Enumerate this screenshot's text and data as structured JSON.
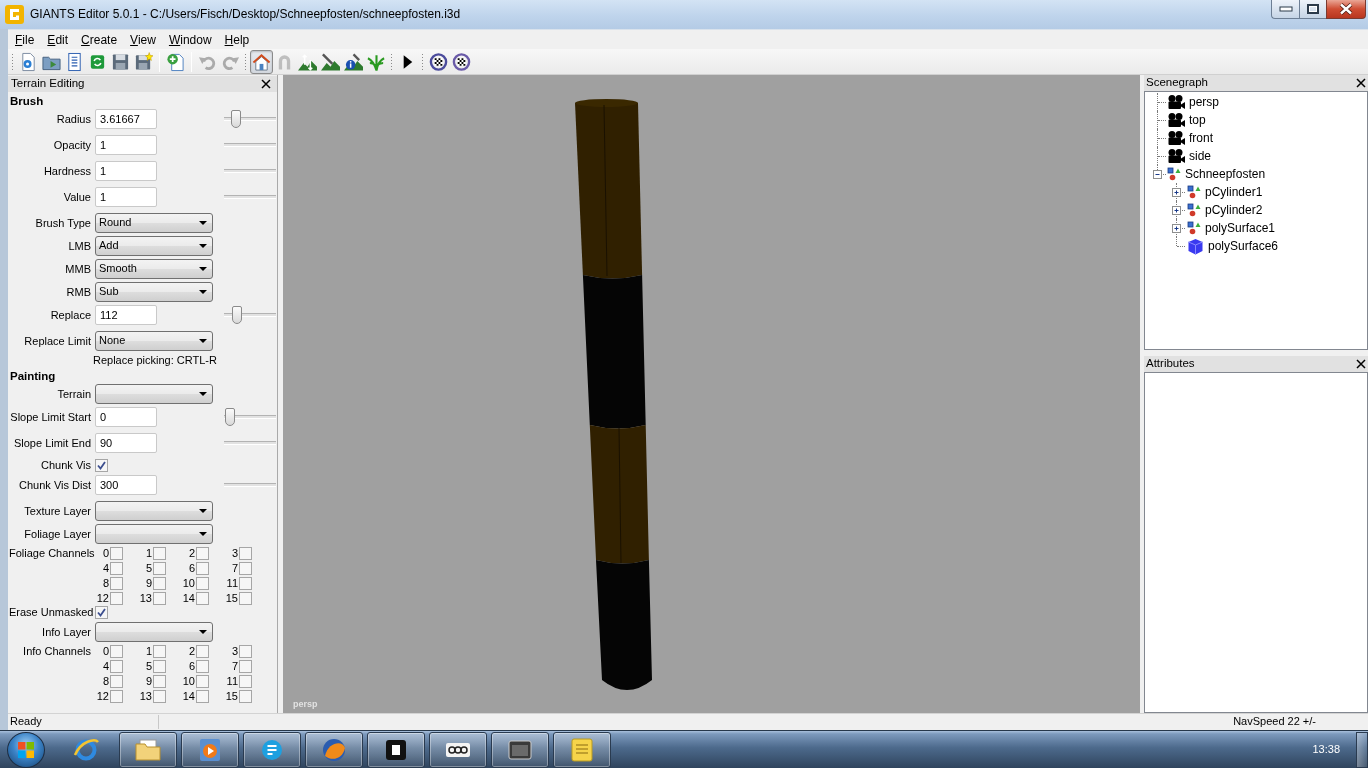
{
  "window": {
    "title": "GIANTS Editor 5.0.1 - C:/Users/Fisch/Desktop/Schneepfosten/schneepfosten.i3d"
  },
  "menu": [
    "File",
    "Edit",
    "Create",
    "View",
    "Window",
    "Help"
  ],
  "toolbar": [
    {
      "kind": "grip"
    },
    {
      "kind": "button",
      "disabled": false,
      "selected": false
    },
    {
      "kind": "button",
      "disabled": false,
      "selected": false
    },
    {
      "kind": "button",
      "disabled": false,
      "selected": false
    },
    {
      "kind": "button",
      "disabled": false,
      "selected": false
    },
    {
      "kind": "button",
      "disabled": false,
      "selected": false
    },
    {
      "kind": "button",
      "disabled": false,
      "selected": false
    },
    {
      "kind": "separator"
    },
    {
      "kind": "button",
      "disabled": false,
      "selected": false
    },
    {
      "kind": "separator"
    },
    {
      "kind": "button",
      "disabled": true,
      "selected": false
    },
    {
      "kind": "button",
      "disabled": true,
      "selected": false
    },
    {
      "kind": "grip"
    },
    {
      "kind": "button",
      "disabled": false,
      "selected": true
    },
    {
      "kind": "button",
      "disabled": true,
      "selected": false
    },
    {
      "kind": "button",
      "disabled": false,
      "selected": false
    },
    {
      "kind": "button",
      "disabled": false,
      "selected": false
    },
    {
      "kind": "button",
      "disabled": false,
      "selected": false
    },
    {
      "kind": "button",
      "disabled": false,
      "selected": false
    },
    {
      "kind": "grip"
    },
    {
      "kind": "button",
      "disabled": false,
      "selected": false
    },
    {
      "kind": "grip"
    },
    {
      "kind": "button",
      "disabled": false,
      "selected": false
    },
    {
      "kind": "button",
      "disabled": false,
      "selected": false
    }
  ],
  "terrain_editing": {
    "title": "Terrain Editing",
    "sections": [
      {
        "heading": "Brush",
        "rows": [
          {
            "kind": "input",
            "label": "Radius",
            "value": "3.61667",
            "slider": {
              "level": 0.16
            }
          },
          {
            "kind": "input",
            "label": "Opacity",
            "value": "1",
            "track": true
          },
          {
            "kind": "input",
            "label": "Hardness",
            "value": "1",
            "track": true
          },
          {
            "kind": "input",
            "label": "Value",
            "value": "1",
            "track": true
          },
          {
            "kind": "select",
            "label": "Brush Type",
            "value": "Round"
          },
          {
            "kind": "select",
            "label": "LMB",
            "value": "Add"
          },
          {
            "kind": "select",
            "label": "MMB",
            "value": "Smooth"
          },
          {
            "kind": "select",
            "label": "RMB",
            "value": "Sub"
          },
          {
            "kind": "input",
            "label": "Replace",
            "value": "112",
            "slider": {
              "level": 0.18
            }
          },
          {
            "kind": "select",
            "label": "Replace Limit",
            "value": "None"
          },
          {
            "kind": "note",
            "text": "Replace picking: CRTL-R"
          }
        ]
      },
      {
        "heading": "Painting",
        "rows": [
          {
            "kind": "select",
            "label": "Terrain"
          },
          {
            "kind": "input",
            "label": "Slope Limit Start",
            "value": "0",
            "slider": {
              "level": 0
            }
          },
          {
            "kind": "input",
            "label": "Slope Limit End",
            "value": "90",
            "track": true
          },
          {
            "kind": "checkbox",
            "label": "Chunk Vis",
            "checked": true
          },
          {
            "kind": "input",
            "label": "Chunk Vis Dist",
            "value": "300",
            "track": true
          },
          {
            "kind": "select",
            "label": "Texture Layer"
          },
          {
            "kind": "select",
            "label": "Foliage Layer"
          },
          {
            "kind": "channels",
            "label": "Foliage Channels",
            "channels": [
              {
                "label": "0",
                "checked": false
              },
              {
                "label": "1",
                "checked": false
              },
              {
                "label": "2",
                "checked": false
              },
              {
                "label": "3",
                "checked": false
              },
              {
                "label": "4",
                "checked": false
              },
              {
                "label": "5",
                "checked": false
              },
              {
                "label": "6",
                "checked": false
              },
              {
                "label": "7",
                "checked": false
              },
              {
                "label": "8",
                "checked": false
              },
              {
                "label": "9",
                "checked": false
              },
              {
                "label": "10",
                "checked": false
              },
              {
                "label": "11",
                "checked": false
              },
              {
                "label": "12",
                "checked": false
              },
              {
                "label": "13",
                "checked": false
              },
              {
                "label": "14",
                "checked": false
              },
              {
                "label": "15",
                "checked": false
              }
            ]
          },
          {
            "kind": "checkbox",
            "label": "Erase Unmasked",
            "checked": true
          },
          {
            "kind": "select",
            "label": "Info Layer"
          },
          {
            "kind": "channels",
            "label": "Info Channels",
            "channels": [
              {
                "label": "0",
                "checked": false
              },
              {
                "label": "1",
                "checked": false
              },
              {
                "label": "2",
                "checked": false
              },
              {
                "label": "3",
                "checked": false
              },
              {
                "label": "4",
                "checked": false
              },
              {
                "label": "5",
                "checked": false
              },
              {
                "label": "6",
                "checked": false
              },
              {
                "label": "7",
                "checked": false
              },
              {
                "label": "8",
                "checked": false
              },
              {
                "label": "9",
                "checked": false
              },
              {
                "label": "10",
                "checked": false
              },
              {
                "label": "11",
                "checked": false
              },
              {
                "label": "12",
                "checked": false
              },
              {
                "label": "13",
                "checked": false
              },
              {
                "label": "14",
                "checked": false
              },
              {
                "label": "15",
                "checked": false
              }
            ]
          }
        ]
      }
    ]
  },
  "viewport": {
    "camera_label": "persp"
  },
  "scenegraph": {
    "title": "Scenegraph",
    "nodes": [
      {
        "label": "persp",
        "kind": "camera"
      },
      {
        "label": "top",
        "kind": "camera"
      },
      {
        "label": "front",
        "kind": "camera"
      },
      {
        "label": "side",
        "kind": "camera"
      },
      {
        "label": "Schneepfosten",
        "kind": "transform",
        "expanded": true,
        "children": [
          {
            "label": "pCylinder1",
            "kind": "transform",
            "expanded": false
          },
          {
            "label": "pCylinder2",
            "kind": "transform",
            "expanded": false
          },
          {
            "label": "polySurface1",
            "kind": "transform",
            "expanded": false
          },
          {
            "label": "polySurface6",
            "kind": "shape"
          }
        ]
      }
    ]
  },
  "attributes": {
    "title": "Attributes"
  },
  "status_bar": {
    "message": "Ready",
    "nav_speed": "NavSpeed 22 +/-"
  },
  "taskbar": {
    "buttons": [
      {
        "running": false
      },
      {
        "running": true
      },
      {
        "running": true
      },
      {
        "running": true
      },
      {
        "running": true
      },
      {
        "running": true
      },
      {
        "running": true
      },
      {
        "running": true
      },
      {
        "running": true
      }
    ],
    "clock": "13:38"
  }
}
